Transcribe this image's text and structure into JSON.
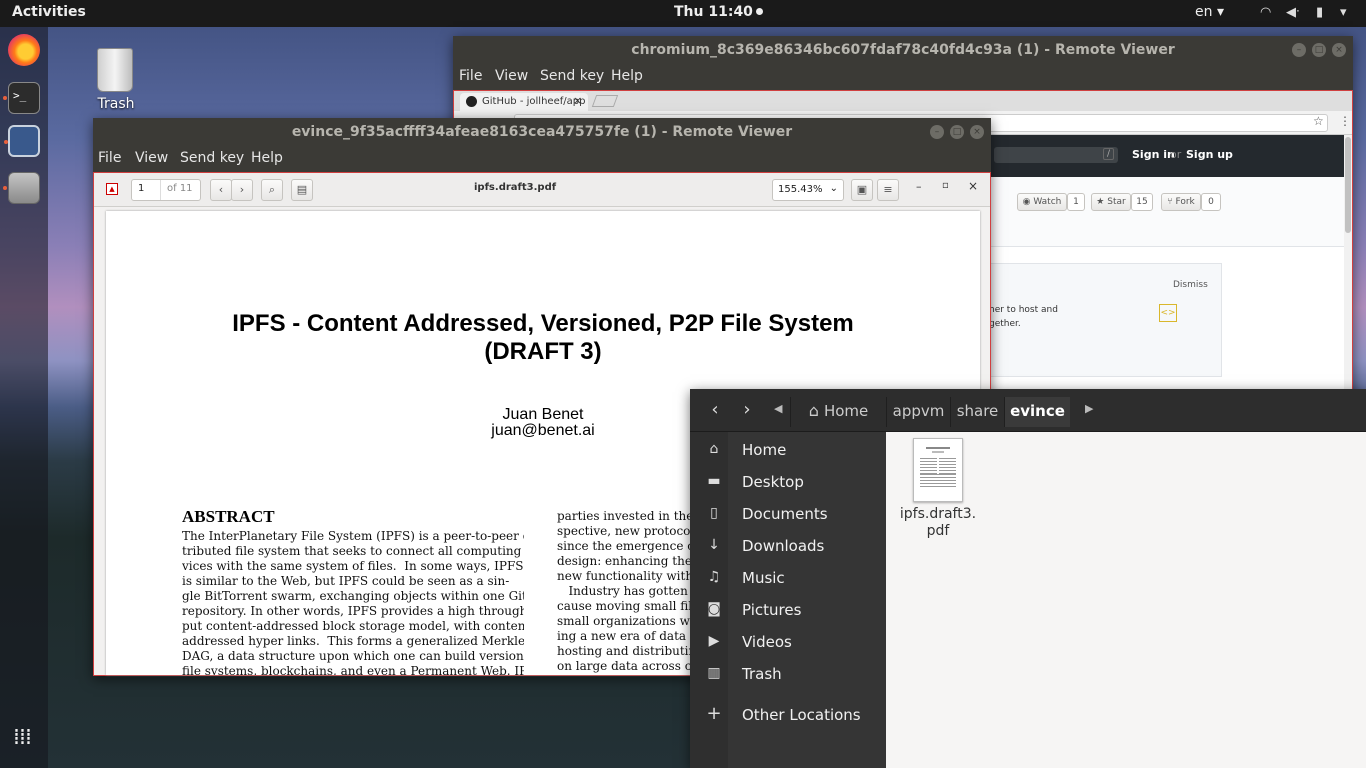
{
  "topbar": {
    "activities": "Activities",
    "clock": "Thu 11:40",
    "lang": "en"
  },
  "desktop": {
    "trash_label": "Trash"
  },
  "chromium_window": {
    "title": "chromium_8c369e86346bc607fdaf78c40fd4c93a (1) - Remote Viewer",
    "menu": {
      "file": "File",
      "view": "View",
      "send_key": "Send key",
      "help": "Help"
    },
    "tab_label": "GitHub - jollheef/app",
    "signin": "Sign in",
    "or": "or",
    "signup": "Sign up",
    "kbd": "/",
    "watch": "Watch",
    "watch_count": "1",
    "star": "Star",
    "star_count": "15",
    "fork": "Fork",
    "fork_count": "0",
    "dismiss": "Dismiss",
    "promo_line1": "her to host and",
    "promo_line2": "gether."
  },
  "evince_window": {
    "title": "evince_9f35acffff34afeae8163cea475757fe (1) - Remote Viewer",
    "menu": {
      "file": "File",
      "view": "View",
      "send_key": "Send key",
      "help": "Help"
    },
    "page_input": "1",
    "page_of": "of 11",
    "filename": "ipfs.draft3.pdf",
    "zoom": "155.43%",
    "doc": {
      "title_line1": "IPFS - Content Addressed, Versioned, P2P File System",
      "title_line2": "(DRAFT 3)",
      "author": "Juan Benet",
      "email": "juan@benet.ai",
      "abstract_heading": "ABSTRACT",
      "abstract_lines": [
        "The InterPlanetary File System (IPFS) is a peer-to-peer dis-",
        "tributed file system that seeks to connect all computing de-",
        "vices with the same system of files.  In some ways, IPFS",
        "is similar to the Web, but IPFS could be seen as a sin-",
        "gle BitTorrent swarm, exchanging objects within one Git",
        "repository. In other words, IPFS provides a high through-",
        "put content-addressed block storage model, with content-",
        "addressed hyper links.  This forms a generalized Merkle",
        "DAG, a data structure upon which one can build versioned",
        "file systems, blockchains, and even a Permanent Web. IPFS"
      ],
      "right_lines": [
        "parties invested in the c",
        "spective, new protocols",
        "since the emergence of",
        "design: enhancing the",
        "new functionality witho",
        "   Industry has gotten",
        "cause moving small file",
        "small organizations wit",
        "ing a new era of data c",
        "hosting and distributin",
        "on large data across c"
      ]
    }
  },
  "files_window": {
    "path": [
      "Home",
      "appvm",
      "share",
      "evince"
    ],
    "sidebar": [
      {
        "icon": "home-icon",
        "label": "Home"
      },
      {
        "icon": "desktop-folder-icon",
        "label": "Desktop"
      },
      {
        "icon": "document-icon",
        "label": "Documents"
      },
      {
        "icon": "download-icon",
        "label": "Downloads"
      },
      {
        "icon": "music-icon",
        "label": "Music"
      },
      {
        "icon": "camera-icon",
        "label": "Pictures"
      },
      {
        "icon": "video-icon",
        "label": "Videos"
      },
      {
        "icon": "trash-icon",
        "label": "Trash"
      }
    ],
    "other_locations": "Other Locations",
    "file_name": "ipfs.draft3.pdf",
    "file_name_line1": "ipfs.draft3.",
    "file_name_line2": "pdf"
  }
}
